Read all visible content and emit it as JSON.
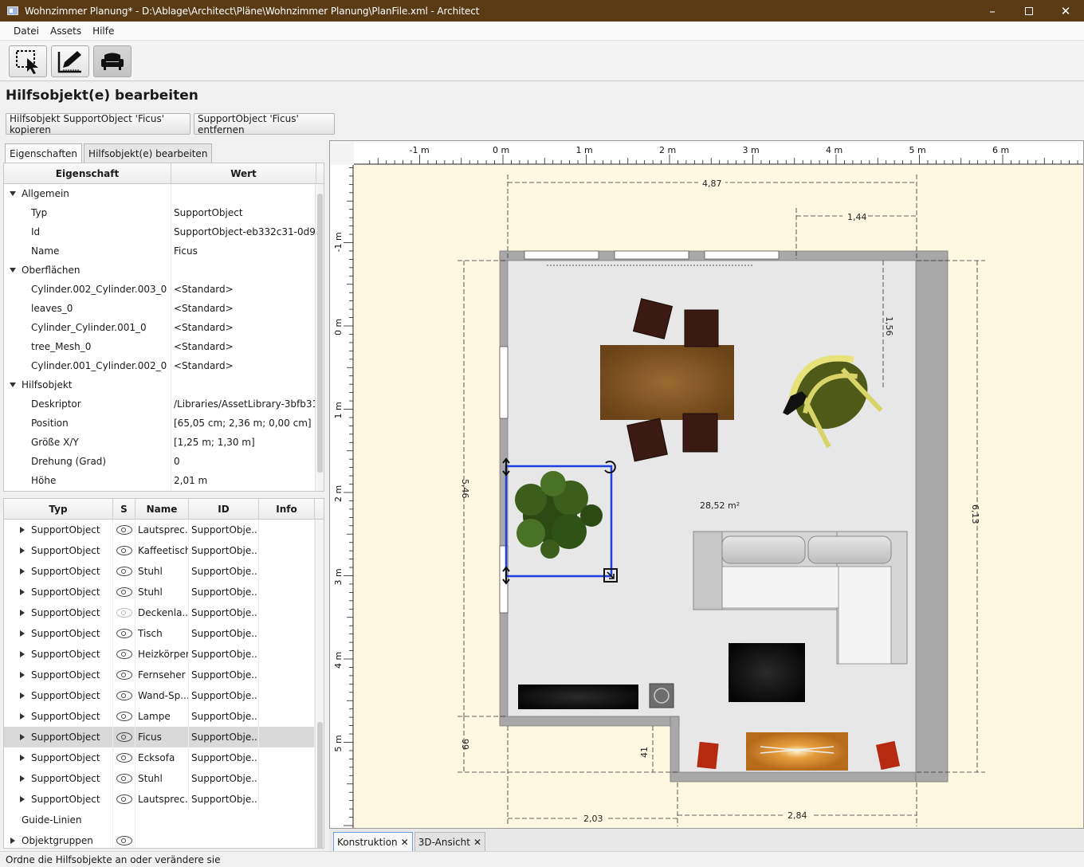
{
  "window": {
    "title": "Wohnzimmer Planung* - D:\\Ablage\\Architect\\Pläne\\Wohnzimmer Planung\\PlanFile.xml - Architect"
  },
  "menu": {
    "items": [
      "Datei",
      "Assets",
      "Hilfe"
    ]
  },
  "toolbar": {
    "buttons": [
      {
        "icon": "select-tool-icon"
      },
      {
        "icon": "draw-tool-icon"
      },
      {
        "icon": "furniture-tool-icon",
        "active": true
      }
    ]
  },
  "page": {
    "heading": "Hilfsobjekt(e) bearbeiten",
    "copy_button": "Hilfsobjekt SupportObject 'Ficus' kopieren",
    "remove_button": "SupportObject 'Ficus' entfernen"
  },
  "tabs": [
    "Eigenschaften",
    "Hilfsobjekt(e) bearbeiten"
  ],
  "properties": {
    "col_property": "Eigenschaft",
    "col_value": "Wert",
    "rows": [
      {
        "k": "Allgemein",
        "v": "",
        "group": true
      },
      {
        "k": "Typ",
        "v": "SupportObject"
      },
      {
        "k": "Id",
        "v": "SupportObject-eb332c31-0d9..."
      },
      {
        "k": "Name",
        "v": "Ficus"
      },
      {
        "k": "Oberflächen",
        "v": "",
        "group": true
      },
      {
        "k": "Cylinder.002_Cylinder.003_0",
        "v": "<Standard>"
      },
      {
        "k": "leaves_0",
        "v": "<Standard>"
      },
      {
        "k": "Cylinder_Cylinder.001_0",
        "v": "<Standard>"
      },
      {
        "k": "tree_Mesh_0",
        "v": "<Standard>"
      },
      {
        "k": "Cylinder.001_Cylinder.002_0",
        "v": "<Standard>"
      },
      {
        "k": "Hilfsobjekt",
        "v": "",
        "group": true
      },
      {
        "k": "Deskriptor",
        "v": "/Libraries/AssetLibrary-3bfb31..."
      },
      {
        "k": "Position",
        "v": "[65,05 cm; 2,36 m; 0,00 cm]"
      },
      {
        "k": "Größe X/Y",
        "v": "[1,25 m; 1,30 m]"
      },
      {
        "k": "Drehung (Grad)",
        "v": "0"
      },
      {
        "k": "Höhe",
        "v": "2,01 m"
      }
    ]
  },
  "objects": {
    "columns": [
      "Typ",
      "S",
      "Name",
      "ID",
      "Info"
    ],
    "rows": [
      {
        "typ": "SupportObject",
        "visible": true,
        "name": "Lautsprec...",
        "id": "SupportObje..."
      },
      {
        "typ": "SupportObject",
        "visible": true,
        "name": "Kaffeetisch",
        "id": "SupportObje..."
      },
      {
        "typ": "SupportObject",
        "visible": true,
        "name": "Stuhl",
        "id": "SupportObje..."
      },
      {
        "typ": "SupportObject",
        "visible": true,
        "name": "Stuhl",
        "id": "SupportObje..."
      },
      {
        "typ": "SupportObject",
        "visible": false,
        "name": "Deckenla...",
        "id": "SupportObje..."
      },
      {
        "typ": "SupportObject",
        "visible": true,
        "name": "Tisch",
        "id": "SupportObje..."
      },
      {
        "typ": "SupportObject",
        "visible": true,
        "name": "Heizkörper",
        "id": "SupportObje..."
      },
      {
        "typ": "SupportObject",
        "visible": true,
        "name": "Fernseher",
        "id": "SupportObje..."
      },
      {
        "typ": "SupportObject",
        "visible": true,
        "name": "Wand-Sp...",
        "id": "SupportObje..."
      },
      {
        "typ": "SupportObject",
        "visible": true,
        "name": "Lampe",
        "id": "SupportObje..."
      },
      {
        "typ": "SupportObject",
        "visible": true,
        "name": "Ficus",
        "id": "SupportObje...",
        "selected": true
      },
      {
        "typ": "SupportObject",
        "visible": true,
        "name": "Ecksofa",
        "id": "SupportObje..."
      },
      {
        "typ": "SupportObject",
        "visible": true,
        "name": "Stuhl",
        "id": "SupportObje..."
      },
      {
        "typ": "SupportObject",
        "visible": true,
        "name": "Lautsprec...",
        "id": "SupportObje..."
      }
    ],
    "guide_lines": "Guide-Linien",
    "object_groups": "Objektgruppen"
  },
  "plan": {
    "ruler_x": [
      "-1 m",
      "0 m",
      "1 m",
      "2 m",
      "3 m",
      "4 m",
      "5 m",
      "6 m"
    ],
    "ruler_y": [
      "-1 m",
      "0 m",
      "1 m",
      "2 m",
      "3 m",
      "4 m",
      "5 m"
    ],
    "dims": {
      "top_width": "4,87",
      "window": "1,44",
      "right_small": "1,56",
      "left_height": "5,46",
      "right_height": "6,13",
      "bottom_left_h": "99",
      "bottom_notch_h": "41",
      "bottom_left_w": "2,03",
      "bottom_right_w": "2,84"
    },
    "area": "28,52 m²",
    "colors": {
      "background": "#fff8e0",
      "floor": "#e6e6e6",
      "wall": "#a6a6a6",
      "selection": "#1f3fe0"
    }
  },
  "bottom_tabs": [
    "Konstruktion",
    "3D-Ansicht"
  ],
  "status": "Ordne die Hilfsobjekte an oder verändere sie"
}
